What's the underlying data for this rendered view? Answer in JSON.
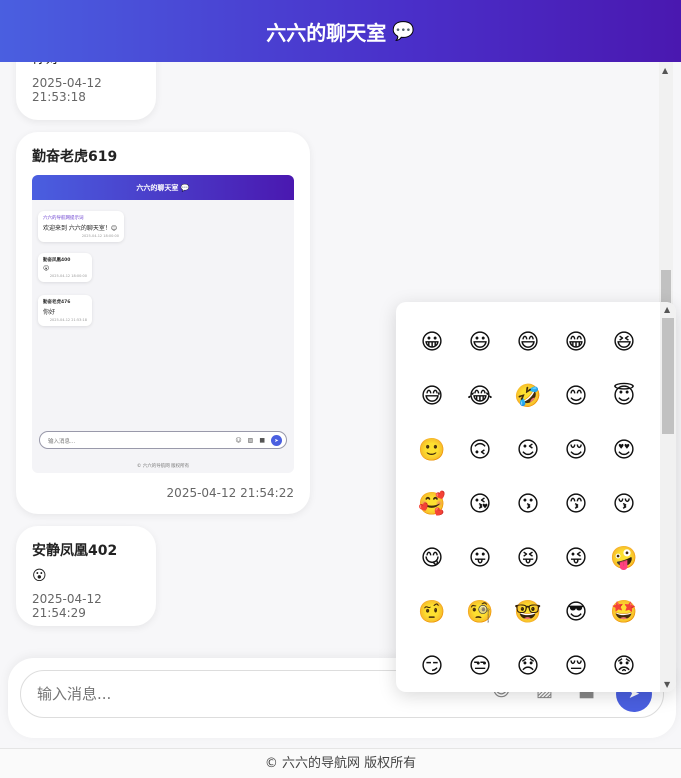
{
  "header": {
    "title": "六六的聊天室",
    "icon": "speech-bubble-icon",
    "icon_glyph": "💬"
  },
  "messages": [
    {
      "text": "你好",
      "time": "2025-04-12 21:53:18"
    },
    {
      "sender": "勤奋老虎619",
      "time": "2025-04-12 21:54:22",
      "image": {
        "title": "六六的聊天室 💬",
        "bubbles": [
          {
            "sender": "六六的导航网提示词",
            "text": "欢迎来到 六六的聊天室！😊",
            "time": "2025-04-12 18:00:00"
          },
          {
            "sender": "勤奋凤凰400",
            "text": "😮",
            "time": "2025-04-12 18:00:00"
          },
          {
            "sender": "勤奋老虎476",
            "text": "你好",
            "time": "2025-04-12 21:53:18"
          }
        ],
        "input_placeholder": "输入消息...",
        "footer": "© 六六的导航网 版权所有"
      }
    },
    {
      "sender": "安静凤凰402",
      "text": "😮",
      "time": "2025-04-12 21:54:29"
    }
  ],
  "input": {
    "placeholder": "输入消息..."
  },
  "tools": [
    {
      "name": "emoji-icon",
      "glyph": "☺"
    },
    {
      "name": "image-icon",
      "glyph": "▨"
    },
    {
      "name": "video-icon",
      "glyph": "■"
    },
    {
      "name": "send-icon",
      "glyph": "➤"
    }
  ],
  "footer": {
    "text": "© 六六的导航网 版权所有"
  },
  "emoji_picker": {
    "emojis": [
      "😀",
      "😃",
      "😄",
      "😁",
      "😆",
      "😅",
      "😂",
      "🤣",
      "😊",
      "😇",
      "🙂",
      "🙃",
      "😉",
      "😌",
      "😍",
      "🥰",
      "😘",
      "😗",
      "😙",
      "😚",
      "😋",
      "😛",
      "😝",
      "😜",
      "🤪",
      "🤨",
      "🧐",
      "🤓",
      "😎",
      "🤩",
      "😏",
      "😒",
      "😞",
      "😔",
      "😟"
    ]
  }
}
